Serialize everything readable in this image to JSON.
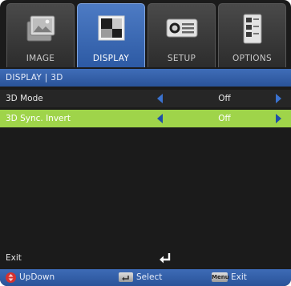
{
  "tabs": [
    {
      "label": "IMAGE",
      "icon": "image-icon",
      "active": false
    },
    {
      "label": "DISPLAY",
      "icon": "display-icon",
      "active": true
    },
    {
      "label": "SETUP",
      "icon": "setup-icon",
      "active": false
    },
    {
      "label": "OPTIONS",
      "icon": "options-icon",
      "active": false
    }
  ],
  "breadcrumb": "DISPLAY | 3D",
  "menu": [
    {
      "label": "3D Mode",
      "value": "Off",
      "selected": false
    },
    {
      "label": "3D Sync. Invert",
      "value": "Off",
      "selected": true
    }
  ],
  "exit": {
    "label": "Exit",
    "icon": "enter-icon"
  },
  "legend": {
    "updown_label": "UpDown",
    "select_label": "Select",
    "menu_key_label": "Menu",
    "exit_label": "Exit"
  },
  "colors": {
    "accent_blue": "#3f6db8",
    "highlight_green": "#9fd44a",
    "background": "#1b1b1b"
  }
}
